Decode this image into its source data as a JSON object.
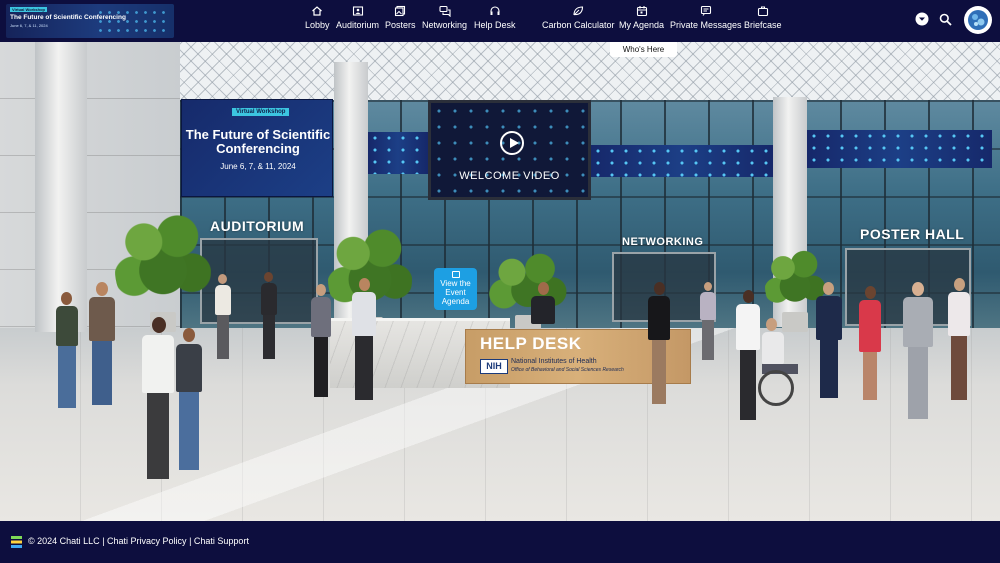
{
  "header": {
    "event_tag": "Virtual Workshop",
    "event_title": "The Future of Scientific Conferencing",
    "event_dates": "June 6, 7, & 11, 2024",
    "nav": [
      {
        "label": "Lobby",
        "icon": "home-icon"
      },
      {
        "label": "Auditorium",
        "icon": "auditorium-icon"
      },
      {
        "label": "Posters",
        "icon": "posters-icon"
      },
      {
        "label": "Networking",
        "icon": "chat-bubbles-icon"
      },
      {
        "label": "Help Desk",
        "icon": "headset-icon"
      },
      {
        "label": "Carbon Calculator",
        "icon": "leaf-icon"
      },
      {
        "label": "My Agenda",
        "icon": "calendar-icon"
      },
      {
        "label": "Private Messages",
        "icon": "message-icon"
      },
      {
        "label": "Briefcase",
        "icon": "briefcase-icon"
      }
    ],
    "whos_here": "Who's Here"
  },
  "lobby": {
    "sign_tag": "Virtual Workshop",
    "sign_title": "The Future of Scientific Conferencing",
    "sign_dates": "June 6, 7, & 11, 2024",
    "welcome_video": "WELCOME VIDEO",
    "auditorium": "AUDITORIUM",
    "networking": "NETWORKING",
    "poster_hall": "POSTER HALL",
    "agenda_button": "View the Event Agenda",
    "help_desk": "HELP DESK",
    "nih_abbr": "NIH",
    "nih_name": "National Institutes of Health",
    "nih_office": "Office of Behavioral and Social Sciences Research"
  },
  "footer": {
    "copyright": "© 2024 Chati LLC",
    "sep": " | ",
    "privacy": "Chati Privacy Policy",
    "support": "Chati Support"
  },
  "colors": {
    "nav_bg": "#0d0e3e",
    "accent_blue": "#1d9fe3",
    "banner_blue": "#1c3f86"
  }
}
